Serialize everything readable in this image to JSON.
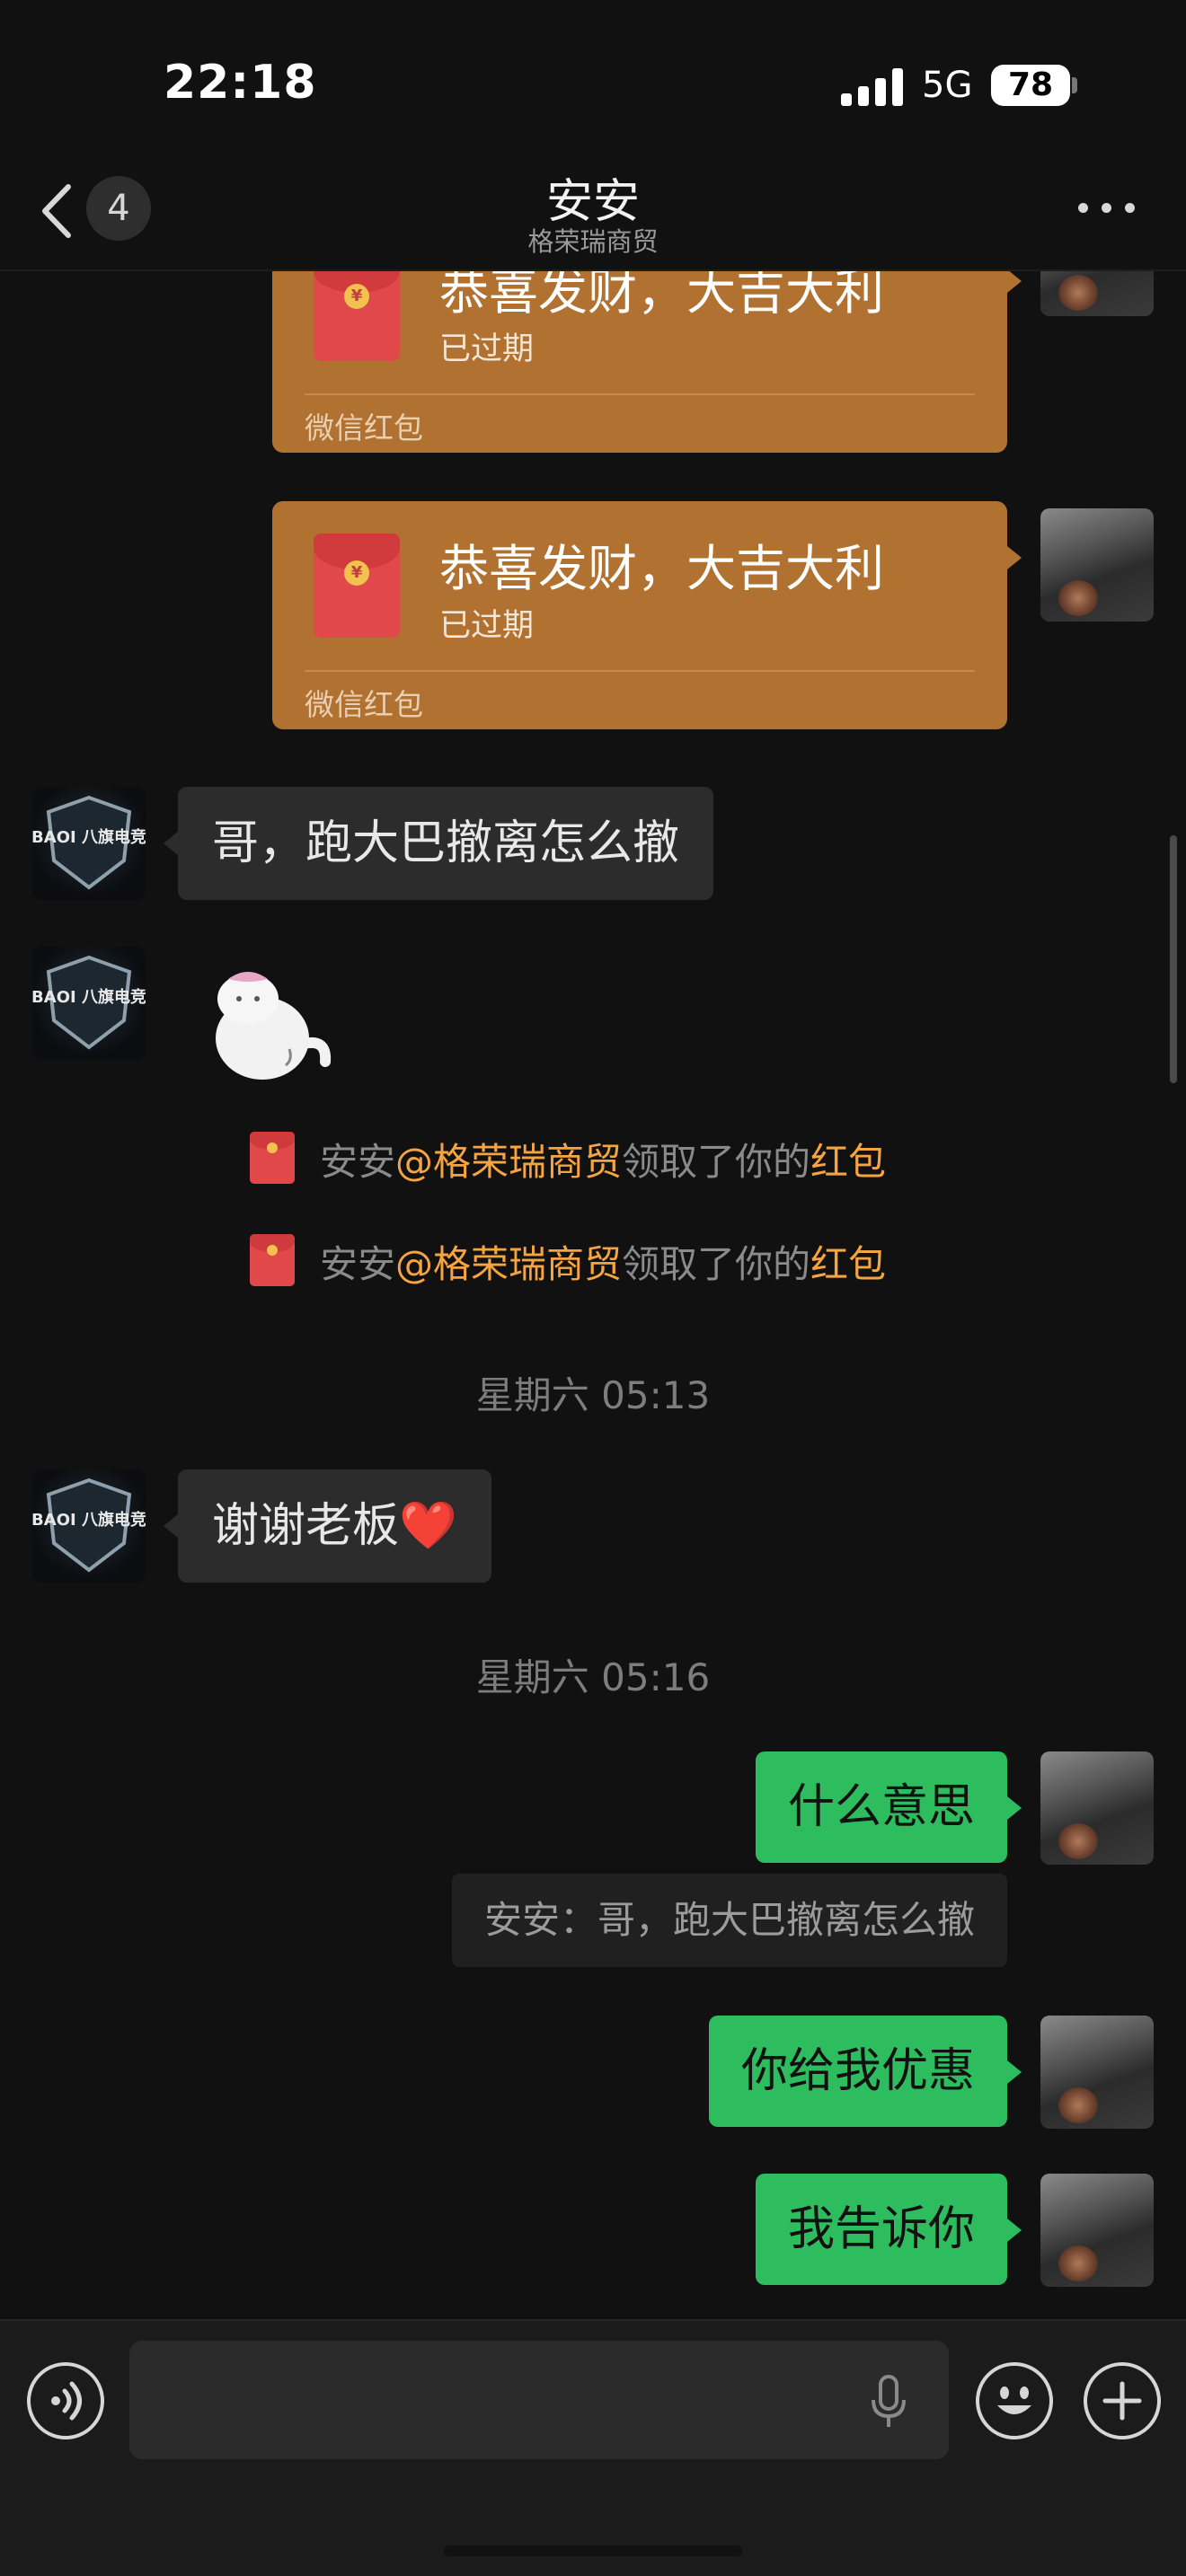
{
  "status_bar": {
    "time": "22:18",
    "network": "5G",
    "battery": "78"
  },
  "nav": {
    "unread_count": "4",
    "title": "安安",
    "subtitle": "格荣瑞商贸"
  },
  "messages": {
    "red_packets": [
      {
        "title": "恭喜发财，大吉大利",
        "status": "已过期",
        "label": "微信红包"
      },
      {
        "title": "恭喜发财，大吉大利",
        "status": "已过期",
        "label": "微信红包"
      }
    ],
    "incoming_1": "哥，跑大巴撤离怎么撤",
    "claims": [
      {
        "name": "安安",
        "group": "@格荣瑞商贸",
        "text": "领取了你的",
        "link": "红包"
      },
      {
        "name": "安安",
        "group": "@格荣瑞商贸",
        "text": "领取了你的",
        "link": "红包"
      }
    ],
    "time_1": "星期六 05:13",
    "incoming_2": "谢谢老板❤️",
    "time_2": "星期六 05:16",
    "outgoing_1": "什么意思",
    "quote_1": "安安：哥，跑大巴撤离怎么撤",
    "outgoing_2": "你给我优惠",
    "outgoing_3": "我告诉你"
  },
  "avatar_logo_text": "BAOI 八旗电竞",
  "packet_coin": "¥",
  "icons": {
    "back": "chevron-left-icon",
    "more": "more-dots-icon",
    "voice": "voice-icon",
    "mic": "microphone-icon",
    "emoji": "emoji-icon",
    "add": "plus-icon"
  },
  "colors": {
    "background": "#111111",
    "red_packet": "#b07131",
    "outgoing_bubble": "#2dbd5f",
    "incoming_bubble": "#2c2c2c",
    "highlight": "#f5a441"
  }
}
